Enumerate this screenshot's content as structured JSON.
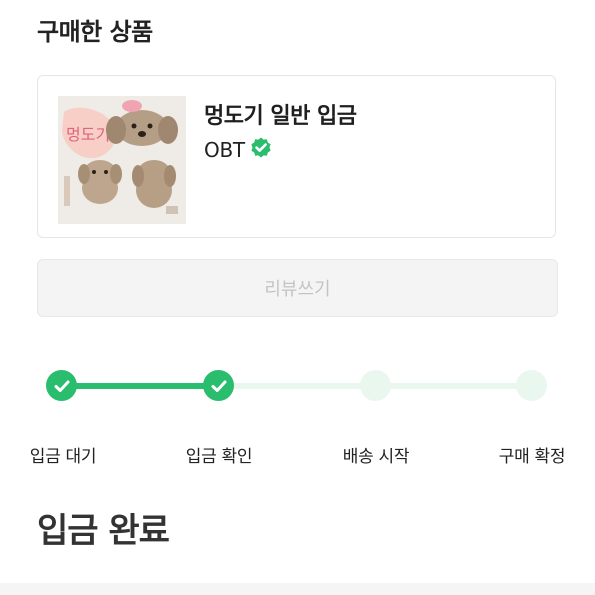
{
  "section": {
    "title": "구매한 상품"
  },
  "product": {
    "name": "멍도기 일반 입금",
    "seller": "OBT",
    "thumbnail_text": "멍도기",
    "thumbnail_icon": "puppy-sticker-image"
  },
  "review_button": {
    "label": "리뷰쓰기"
  },
  "progress": {
    "steps": [
      {
        "label": "입금 대기",
        "done": true
      },
      {
        "label": "입금 확인",
        "done": true
      },
      {
        "label": "배송 시작",
        "done": false
      },
      {
        "label": "구매 확정",
        "done": false
      }
    ],
    "completed_steps": 2
  },
  "status": {
    "title": "입금 완료"
  },
  "colors": {
    "accent": "#2bbd6e",
    "pending": "#eaf7ef",
    "disabled_text": "#c4c4c4"
  }
}
